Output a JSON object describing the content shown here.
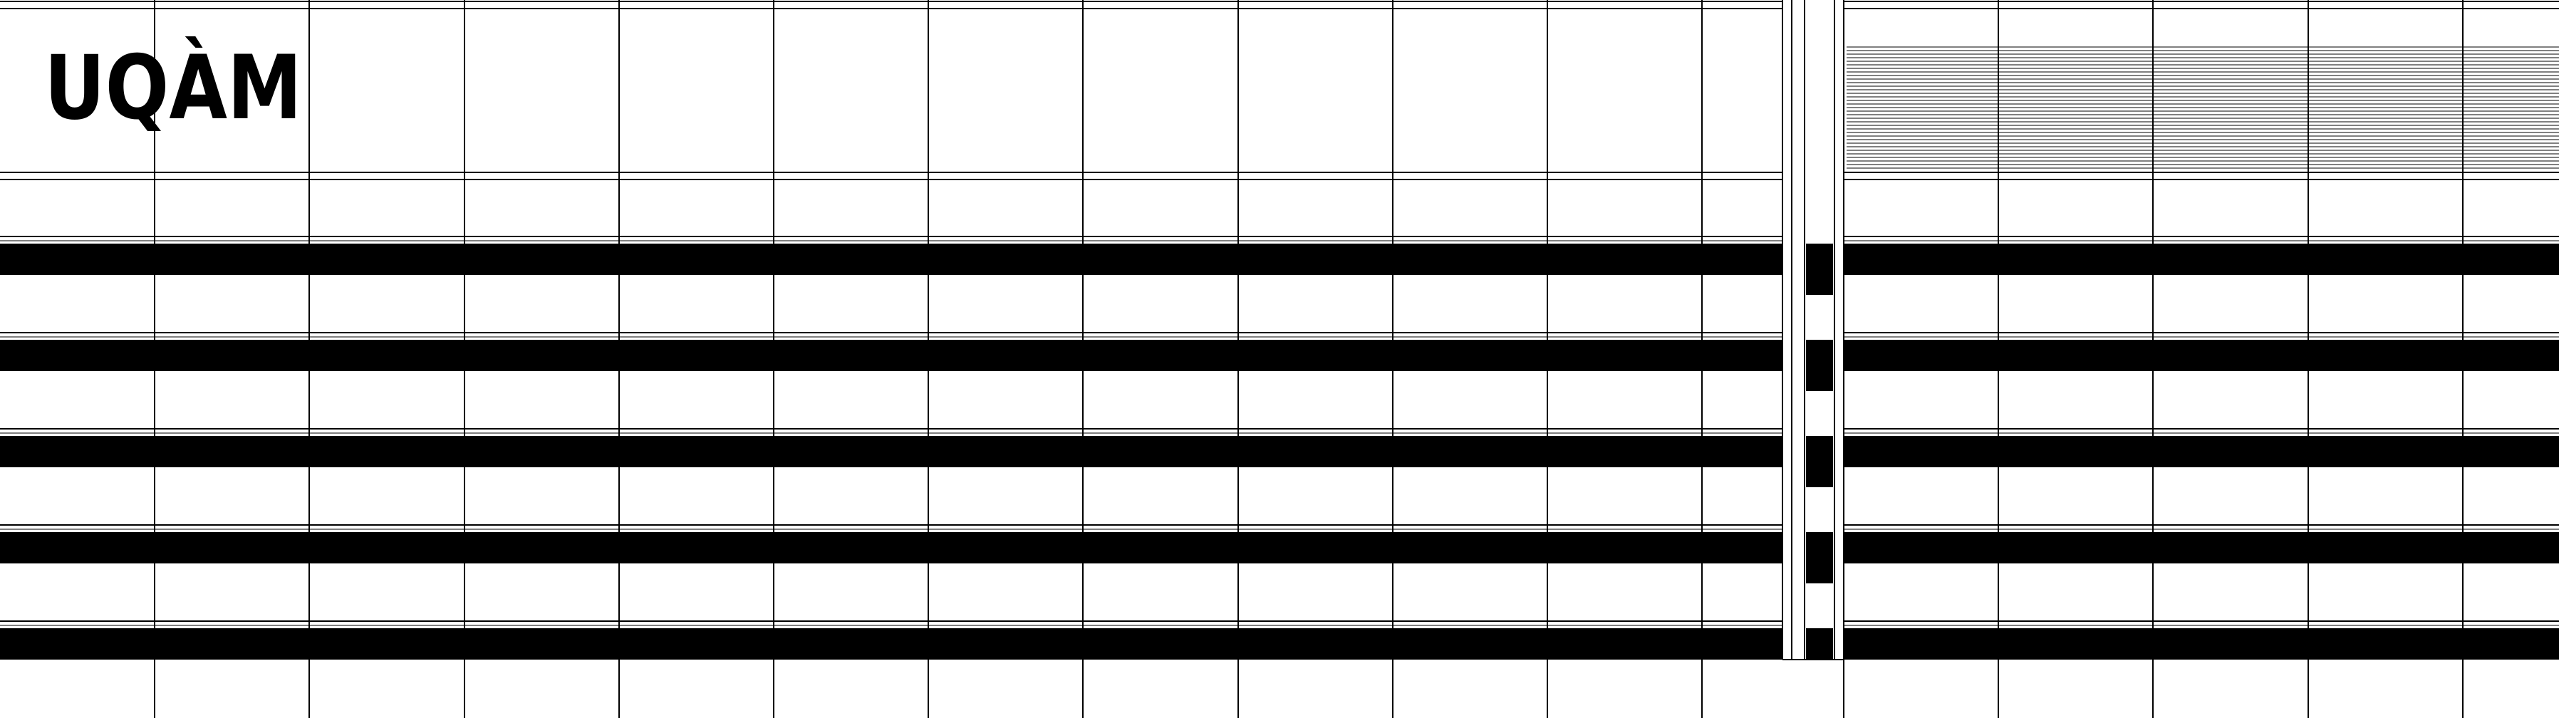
{
  "logo": {
    "text": "UQÀM",
    "color": "#000000"
  },
  "colors": {
    "background": "#ffffff",
    "ink": "#000000"
  },
  "pattern": {
    "band_count": 5,
    "left_columns": 12,
    "right_columns": 5,
    "checker_cells": 9
  }
}
